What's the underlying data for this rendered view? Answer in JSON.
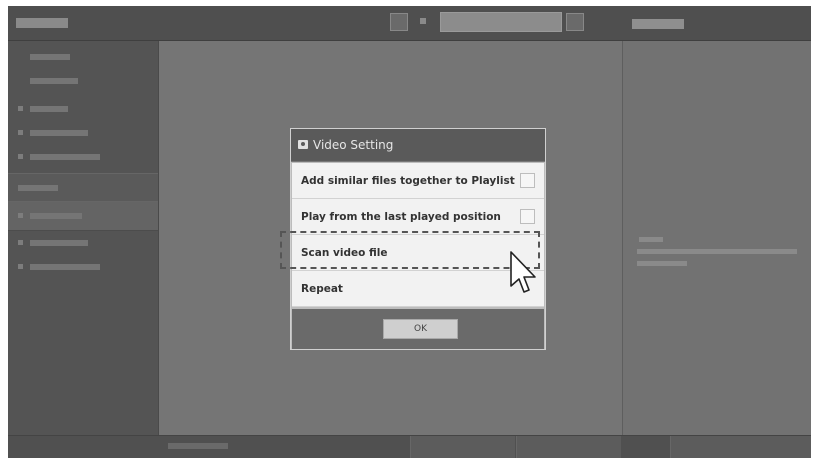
{
  "dialog": {
    "title": "Video Setting",
    "options": [
      {
        "label": "Add similar files together to Playlist",
        "has_checkbox": true,
        "checked": false
      },
      {
        "label": "Play from the last played position",
        "has_checkbox": true,
        "checked": false
      },
      {
        "label": "Scan video file",
        "has_checkbox": false,
        "highlighted": true
      },
      {
        "label": "Repeat",
        "has_checkbox": false
      }
    ],
    "ok_label": "OK"
  },
  "icons": {
    "dialog_icon": "camera-icon",
    "pointer": "mouse-cursor-icon"
  },
  "colors": {
    "dialog_header": "#5a5a5a",
    "dialog_row": "#f2f2f2",
    "highlight_border": "#555555"
  }
}
